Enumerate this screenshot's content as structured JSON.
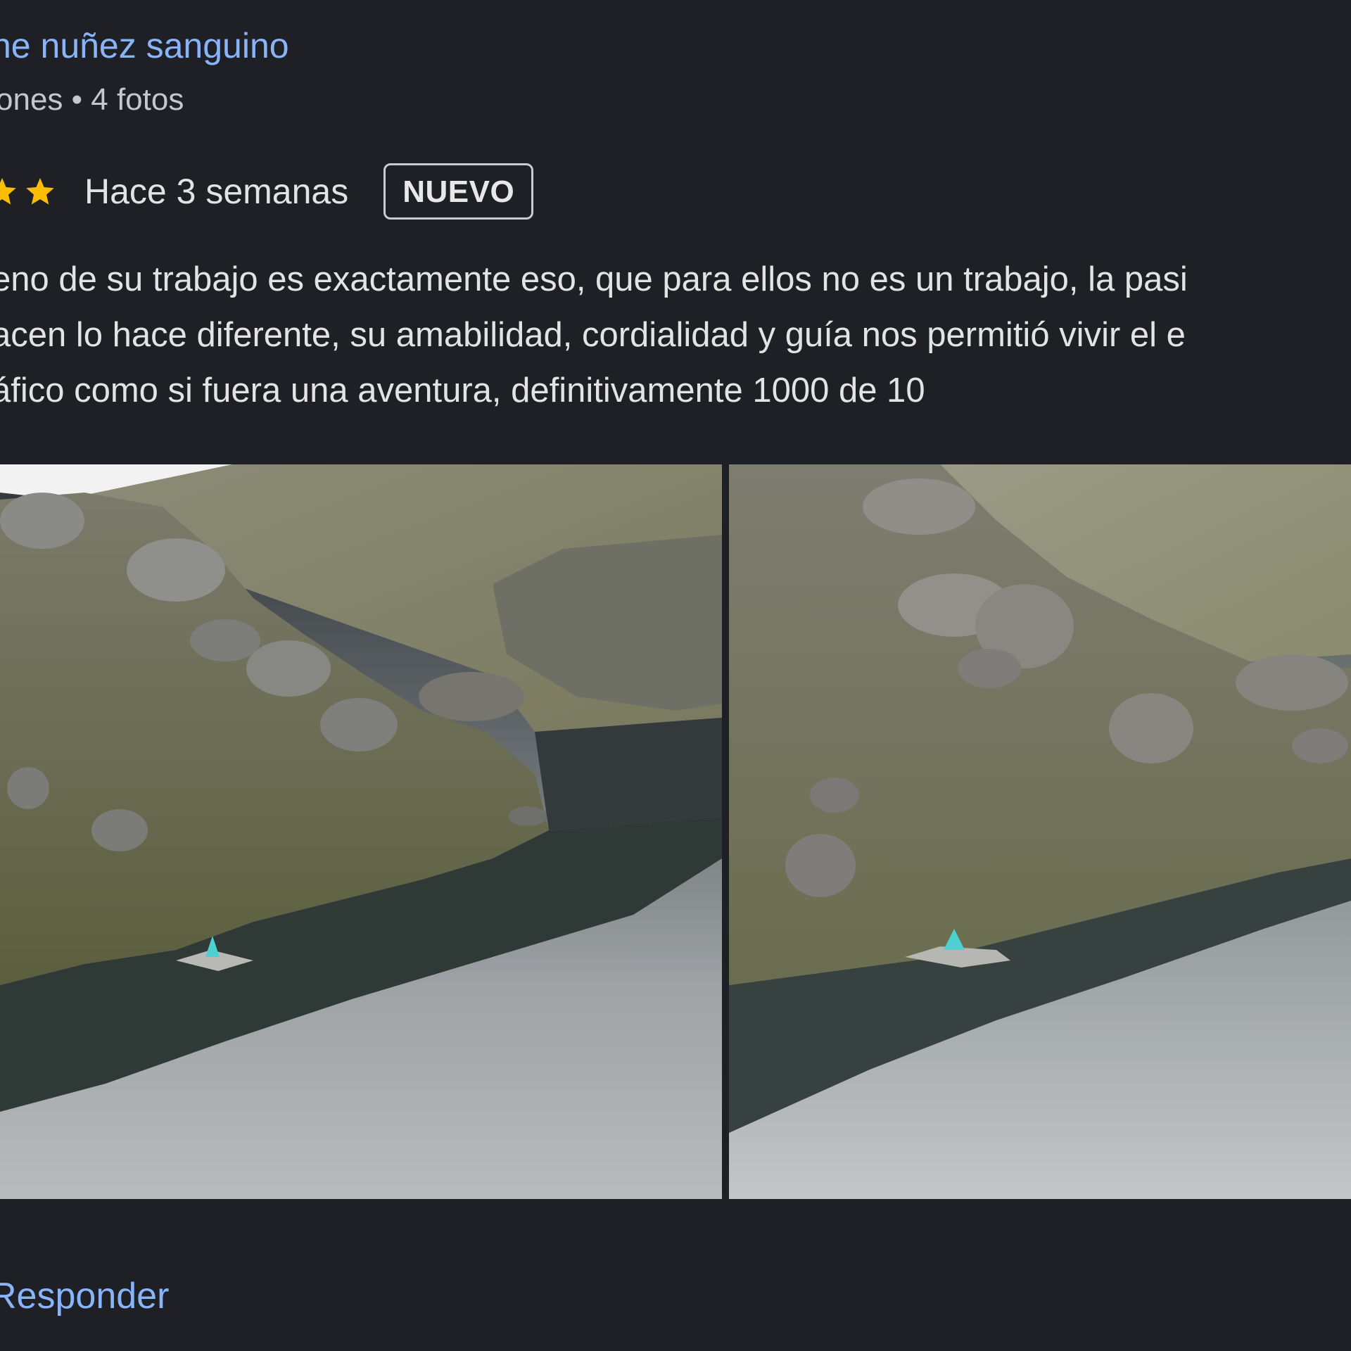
{
  "review": {
    "author_name": "ne nuñez sanguino",
    "author_meta": "ones • 4 fotos",
    "rating_stars_visible": 2,
    "star_color": "#fbbc04",
    "date": "Hace 3 semanas",
    "badge": "NUEVO",
    "text_lines": [
      "eno de su trabajo es exactamente eso, que para ellos no es un trabajo, la pasi",
      "acen lo hace diferente, su amabilidad, cordialidad y guía nos permitió vivir el e",
      "áfico como si fuera una aventura, definitivamente 1000 de 10"
    ],
    "photos": [
      {
        "icon": "landscape-photo-lake"
      },
      {
        "icon": "landscape-photo-lake"
      }
    ],
    "reply_label": "Responder"
  },
  "colors": {
    "background": "#1f2025",
    "link": "#8ab4f8",
    "text": "#e3e3e3"
  }
}
